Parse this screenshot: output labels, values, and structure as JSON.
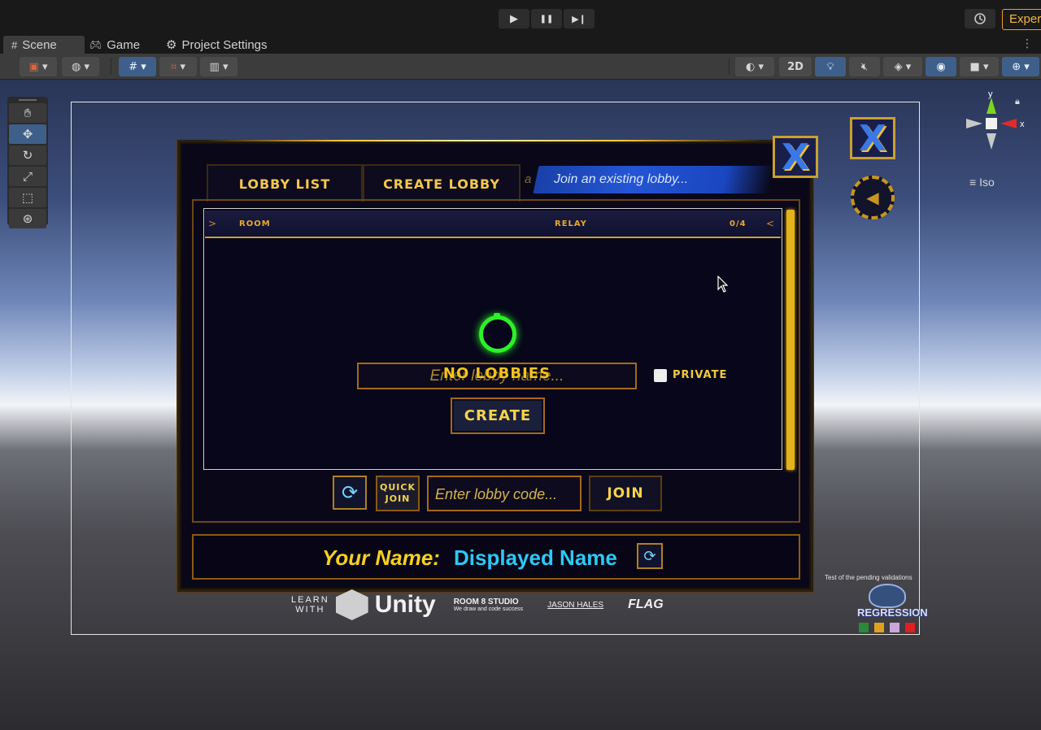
{
  "editor": {
    "play_icon": "▶",
    "pause_icon": "❚❚",
    "step_icon": "▶❙",
    "history_icon": "history-icon",
    "account_label": "Exper"
  },
  "tabs": [
    {
      "label": "Scene",
      "icon": "grid-icon"
    },
    {
      "label": "Game",
      "icon": "gamepad-icon"
    },
    {
      "label": "Project Settings",
      "icon": "gear-icon"
    }
  ],
  "scene_toolbar": {
    "mode_2d": "2D"
  },
  "gizmo": {
    "y_label": "y",
    "x_label": "x",
    "projection": "Iso"
  },
  "lobby": {
    "tab_list": "LOBBY LIST",
    "tab_create": "CREATE LOBBY",
    "hint_prefix": "a",
    "hint": "Join an existing lobby...",
    "header": {
      "room": "ROOM",
      "relay": "RELAY",
      "count": "0/4"
    },
    "empty_text": "NO LOBBIES",
    "name_placeholder": "Enter lobby name...",
    "private_label": "PRIVATE",
    "create_label": "CREATE",
    "quick_join_line1": "QUICK",
    "quick_join_line2": "JOIN",
    "code_placeholder": "Enter lobby code...",
    "join_label": "JOIN",
    "your_name_label": "Your Name:",
    "your_name_value": "Displayed Name"
  },
  "logos": {
    "learn_line1": "LEARN",
    "learn_line2": "WITH",
    "unity": "Unity",
    "room8": "ROOM 8 STUDIO",
    "room8_sub": "We draw and code success",
    "jason": "JASON HALES",
    "flag": "FLAG"
  },
  "regression": {
    "note": "Test of the pending validations",
    "name": "REGRESSION",
    "swatch_colors": [
      "#2a8a3a",
      "#e0a020",
      "#c8a8d8",
      "#e02020"
    ]
  },
  "colors": {
    "accent_gold": "#f5c84a",
    "accent_blue": "#2cc9f5",
    "spinner_green": "#2cf028",
    "editor_blue": "#3e5f8a"
  }
}
